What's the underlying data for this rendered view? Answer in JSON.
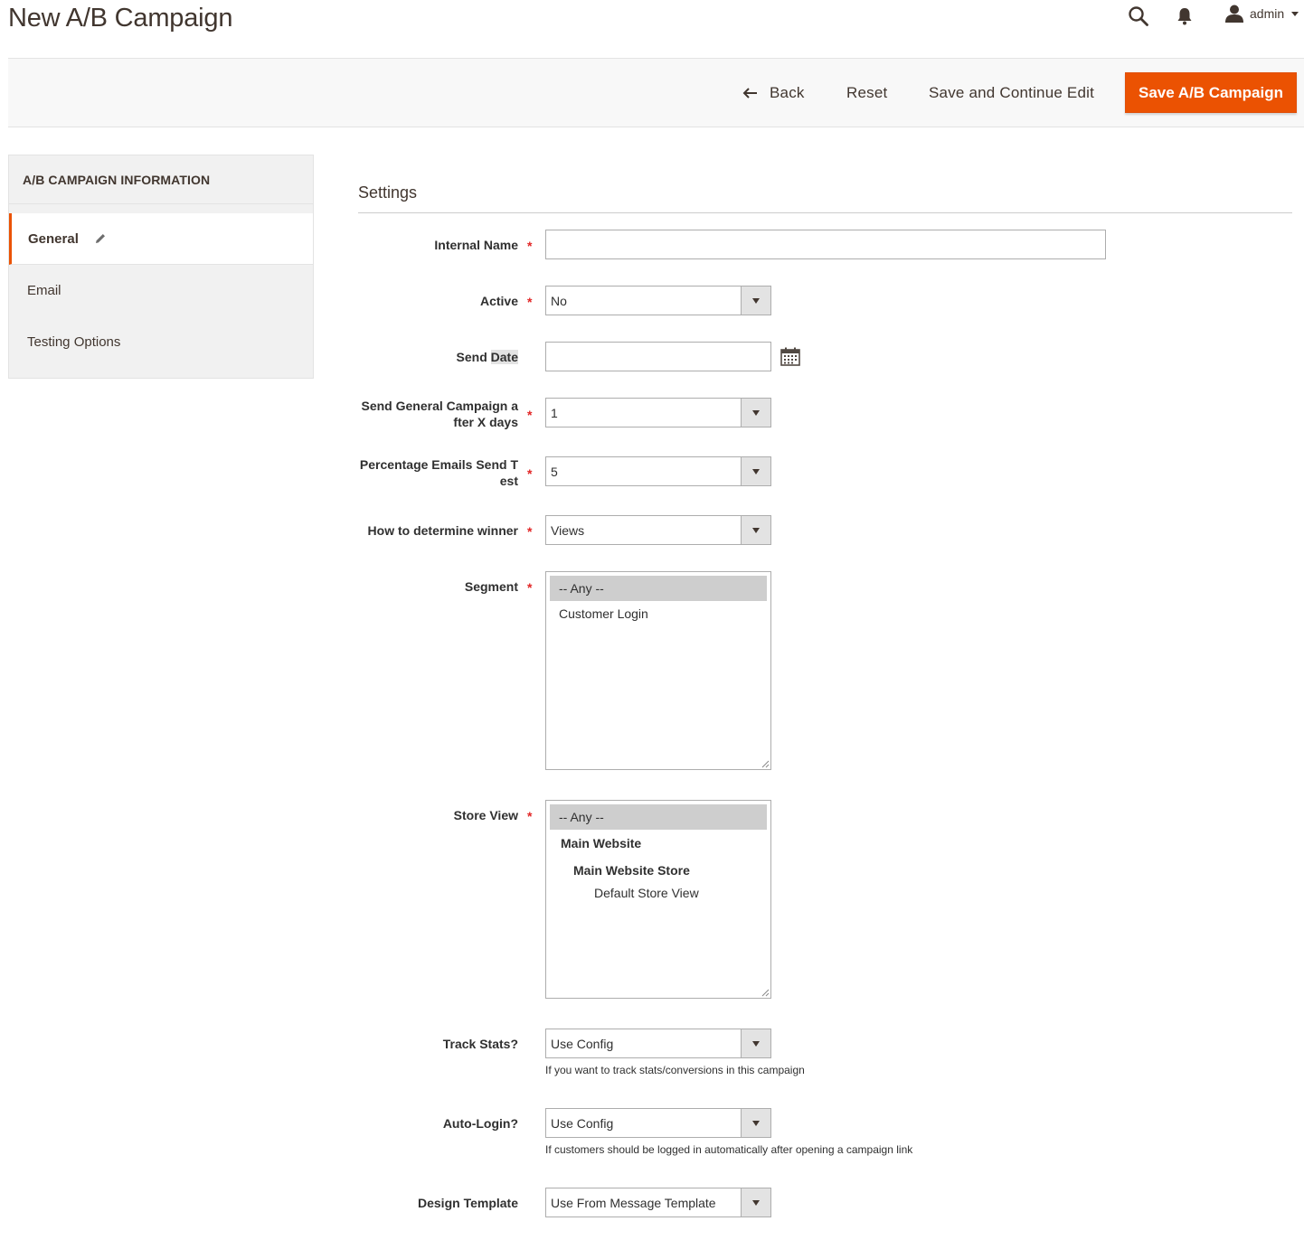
{
  "page": {
    "title": "New A/B Campaign"
  },
  "header": {
    "user_name": "admin"
  },
  "toolbar": {
    "back_label": "Back",
    "reset_label": "Reset",
    "save_continue_label": "Save and Continue Edit",
    "save_label": "Save A/B Campaign",
    "accent_color": "#eb5202"
  },
  "sidebar": {
    "title": "A/B Campaign Information",
    "items": [
      {
        "label": "General"
      },
      {
        "label": "Email"
      },
      {
        "label": "Testing Options"
      }
    ]
  },
  "settings": {
    "title": "Settings",
    "internal_name": {
      "label": "Internal Name",
      "value": "",
      "required": "*"
    },
    "active": {
      "label": "Active",
      "value": "No",
      "required": "*"
    },
    "send_date": {
      "label_part1": "Send ",
      "label_part2": "Date",
      "value": ""
    },
    "send_general": {
      "label_line1": "Send General Campaign a",
      "label_line2": "fter X days",
      "value": "1",
      "required": "*"
    },
    "percentage": {
      "label_line1": "Percentage Emails Send T",
      "label_line2": "est",
      "value": "5",
      "required": "*"
    },
    "winner": {
      "label": "How to determine winner",
      "value": "Views",
      "required": "*"
    },
    "segment": {
      "label": "Segment",
      "required": "*",
      "options": [
        "-- Any --",
        "Customer Login"
      ]
    },
    "store_view": {
      "label": "Store View",
      "required": "*",
      "any_option": "-- Any --",
      "website": "Main Website",
      "store": "Main Website Store",
      "view": "Default Store View"
    },
    "track_stats": {
      "label": "Track Stats?",
      "value": "Use Config",
      "note": "If you want to track stats/conversions in this campaign"
    },
    "auto_login": {
      "label": "Auto-Login?",
      "value": "Use Config",
      "note": "If customers should be logged in automatically after opening a campaign link"
    },
    "design_template": {
      "label": "Design Template",
      "value": "Use From Message Template"
    }
  }
}
